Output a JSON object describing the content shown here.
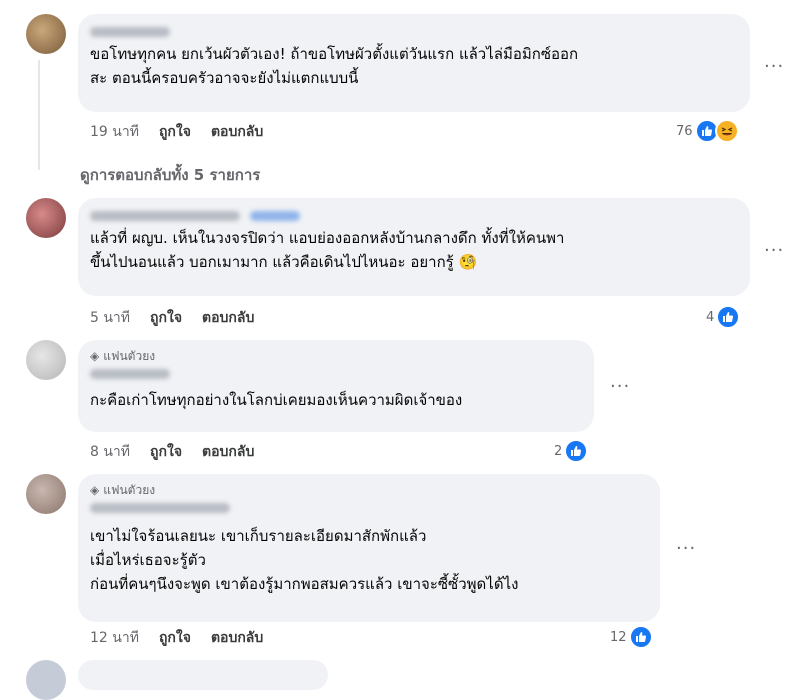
{
  "comments": [
    {
      "text_lines": [
        "ขอโทษทุกคน ยกเว้นผัวตัวเอง! ถ้าขอโทษผัวตั้งแต่วันแรก แล้วไล่มือมิกซ์ออก",
        "สะ ตอนนี้ครอบครัวอาจจะยังไม่แตกแบบนี้"
      ],
      "time": "19 นาที",
      "like": "ถูกใจ",
      "reply": "ตอบกลับ",
      "count": "76",
      "reactions": [
        "like-icon",
        "haha-icon"
      ]
    },
    {
      "text_lines": [
        "แล้วที่ ผญบ. เห็นในวงจรปิดว่า แอบย่องออกหลังบ้านกลางดึก ทั้งที่ให้คนพา",
        "ขึ้นไปนอนแล้ว บอกเมามาก แล้วคือเดินไปไหนอะ อยากรู้ 🧐"
      ],
      "time": "5 นาที",
      "like": "ถูกใจ",
      "reply": "ตอบกลับ",
      "count": "4",
      "reactions": [
        "like-icon"
      ]
    },
    {
      "badge": "แฟนตัวยง",
      "text_lines": [
        "กะคือเก่าโทษทุกอย่างในโลกบ่เคยมองเห็นความผิดเจ้าของ"
      ],
      "time": "8 นาที",
      "like": "ถูกใจ",
      "reply": "ตอบกลับ",
      "count": "2",
      "reactions": [
        "like-icon"
      ]
    },
    {
      "badge": "แฟนตัวยง",
      "text_lines": [
        "เขาไม่ใจร้อนเลยนะ เขาเก็บรายละเอียดมาสักพักแล้ว",
        "เมื่อไหร่เธอจะรู้ตัว",
        "ก่อนที่คนๆนึงจะพูด เขาต้องรู้มากพอสมควรแล้ว เขาจะซี้ซั้วพูดได้ไง"
      ],
      "time": "12 นาที",
      "like": "ถูกใจ",
      "reply": "ตอบกลับ",
      "count": "12",
      "reactions": [
        "like-icon"
      ]
    }
  ],
  "view_replies": "ดูการตอบกลับทั้ง 5 รายการ",
  "more_label": "···",
  "colors": {
    "bubble": "#f0f2f5",
    "like": "#1877f2",
    "haha": "#f7b125",
    "meta": "#65676b"
  }
}
